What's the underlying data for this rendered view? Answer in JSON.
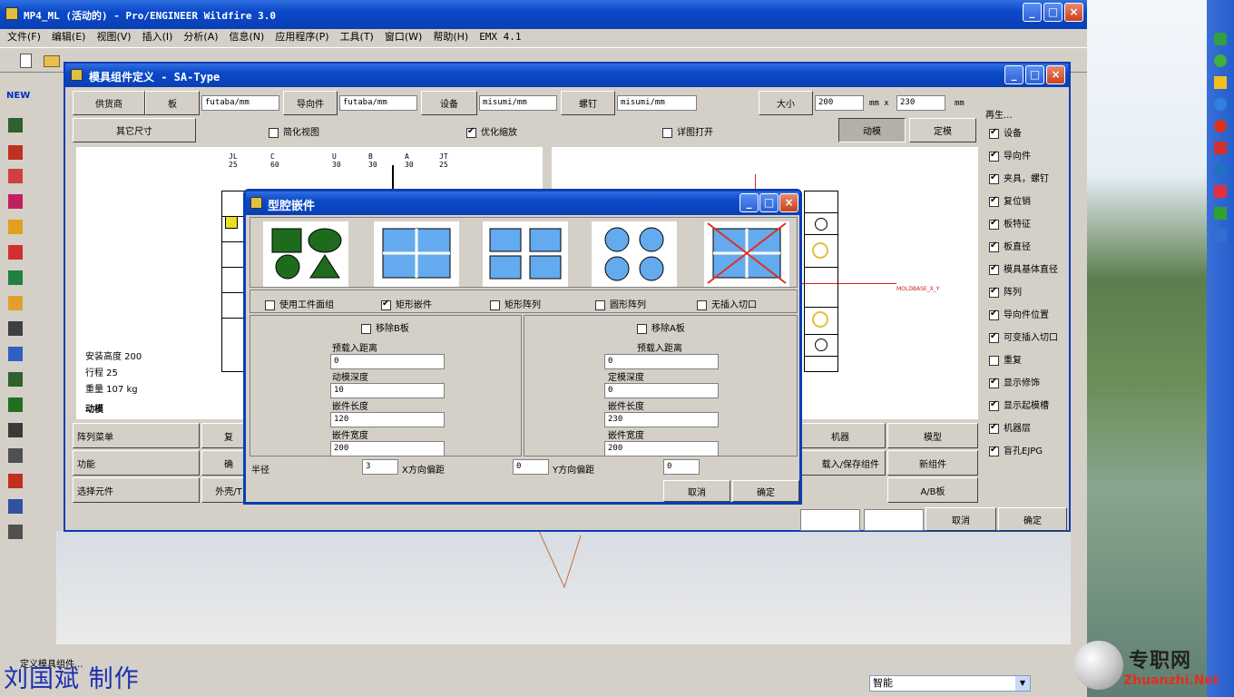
{
  "app": {
    "title": "MP4_ML (活动的) - Pro/ENGINEER Wildfire 3.0",
    "menu": [
      "文件(F)",
      "编辑(E)",
      "视图(V)",
      "插入(I)",
      "分析(A)",
      "信息(N)",
      "应用程序(P)",
      "工具(T)",
      "窗口(W)",
      "帮助(H)",
      "EMX 4.1"
    ],
    "status_message": "定义模具组件...",
    "filter_value": "智能",
    "watermark": "刘国斌 制作"
  },
  "mold_dialog": {
    "title": "模具组件定义 - SA-Type",
    "row1": {
      "supplier_label": "供货商",
      "plate_button": "板",
      "plate_value": "futaba/mm",
      "guide_button": "导向件",
      "guide_value": "futaba/mm",
      "equipment_button": "设备",
      "equipment_value": "misumi/mm",
      "screw_button": "螺钉",
      "screw_value": "misumi/mm",
      "size_button": "大小",
      "size_x": "200",
      "size_unit1": "mm x",
      "size_y": "230",
      "size_unit2": "mm"
    },
    "row2": {
      "other_dims_button": "其它尺寸",
      "simplified_view": "简化视图",
      "optimize_zoom": "优化缩放",
      "detail_open": "详图打开",
      "dynamic_mold_button": "动模",
      "fixed_mold_button": "定模"
    },
    "plate_labels": [
      "JL",
      "C",
      "U",
      "B",
      "A",
      "JT"
    ],
    "plate_values": [
      "25",
      "60",
      "30",
      "30",
      "30",
      "25"
    ],
    "info": {
      "install_height": "安装高度 200",
      "stroke": "行程 25",
      "weight": "重量 107 kg",
      "mode": "动模"
    },
    "bottom_rows": [
      {
        "label": "阵列菜单",
        "btn": "复"
      },
      {
        "label": "功能",
        "btn": "确"
      },
      {
        "label": "选择元件",
        "btn": "外壳/T"
      }
    ],
    "right_buttons": [
      [
        "机器",
        "模型"
      ],
      [
        "载入/保存组件",
        "新组件"
      ],
      [
        "",
        "A/B板"
      ]
    ],
    "cancel_button": "取消",
    "ok_button": "确定",
    "drawing_label": "MOLDBASE_X_Y",
    "side_panel": {
      "header": "再生...",
      "items": [
        {
          "label": "设备",
          "checked": true
        },
        {
          "label": "导向件",
          "checked": true
        },
        {
          "label": "夹具，螺钉",
          "checked": true
        },
        {
          "label": "复位销",
          "checked": true
        },
        {
          "label": "板特征",
          "checked": true
        },
        {
          "label": "板直径",
          "checked": true
        },
        {
          "label": "模具基体直径",
          "checked": true
        },
        {
          "label": "阵列",
          "checked": true
        },
        {
          "label": "导向件位置",
          "checked": true
        },
        {
          "label": "可变插入切口",
          "checked": true
        },
        {
          "label": "重复",
          "checked": false
        },
        {
          "label": "显示修饰",
          "checked": true
        },
        {
          "label": "显示起模槽",
          "checked": true
        },
        {
          "label": "机器层",
          "checked": true
        },
        {
          "label": "盲孔EJPG",
          "checked": true
        }
      ]
    }
  },
  "insert_dialog": {
    "title": "型腔嵌件",
    "options": [
      {
        "label": "使用工件面组",
        "checked": false
      },
      {
        "label": "矩形嵌件",
        "checked": true
      },
      {
        "label": "矩形阵列",
        "checked": false
      },
      {
        "label": "圆形阵列",
        "checked": false
      },
      {
        "label": "无插入切口",
        "checked": false
      }
    ],
    "left": {
      "remove_label": "移除B板",
      "preload_label": "预载入距离",
      "preload_value": "0",
      "depth_label": "动模深度",
      "depth_value": "10",
      "length_label": "嵌件长度",
      "length_value": "120",
      "width_label": "嵌件宽度",
      "width_value": "200"
    },
    "right": {
      "remove_label": "移除A板",
      "preload_label": "预载入距离",
      "preload_value": "0",
      "depth_label": "定模深度",
      "depth_value": "0",
      "length_label": "嵌件长度",
      "length_value": "230",
      "width_label": "嵌件宽度",
      "width_value": "200"
    },
    "radius_label": "半径",
    "radius_value": "3",
    "x_offset_label": "X方向偏距",
    "x_offset_value": "0",
    "y_offset_label": "Y方向偏距",
    "y_offset_value": "0",
    "cancel_button": "取消",
    "ok_button": "确定"
  },
  "site_logo": {
    "cn": "专职网",
    "en": "Zhuanzhi.Net"
  }
}
